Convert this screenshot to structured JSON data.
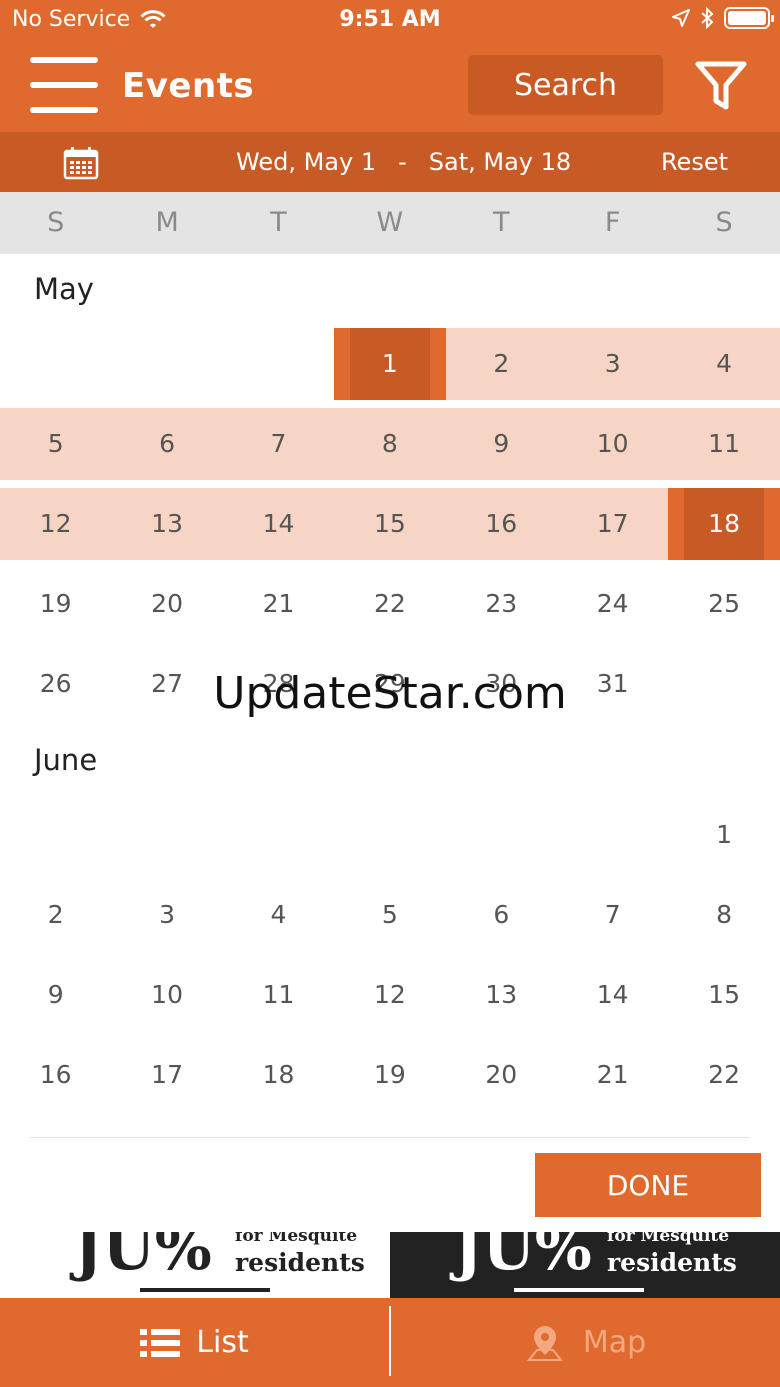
{
  "status": {
    "carrier": "No Service",
    "time": "9:51 AM"
  },
  "header": {
    "title": "Events",
    "search_label": "Search"
  },
  "date_bar": {
    "start": "Wed, May 1",
    "separator": "-",
    "end": "Sat, May 18",
    "reset_label": "Reset"
  },
  "weekdays": [
    "S",
    "M",
    "T",
    "W",
    "T",
    "F",
    "S"
  ],
  "months": [
    {
      "name": "May",
      "weeks": [
        [
          "",
          "",
          "",
          "1",
          "2",
          "3",
          "4"
        ],
        [
          "5",
          "6",
          "7",
          "8",
          "9",
          "10",
          "11"
        ],
        [
          "12",
          "13",
          "14",
          "15",
          "16",
          "17",
          "18"
        ],
        [
          "19",
          "20",
          "21",
          "22",
          "23",
          "24",
          "25"
        ],
        [
          "26",
          "27",
          "28",
          "29",
          "30",
          "31",
          ""
        ]
      ]
    },
    {
      "name": "June",
      "weeks": [
        [
          "",
          "",
          "",
          "",
          "",
          "",
          "1"
        ],
        [
          "2",
          "3",
          "4",
          "5",
          "6",
          "7",
          "8"
        ],
        [
          "9",
          "10",
          "11",
          "12",
          "13",
          "14",
          "15"
        ],
        [
          "16",
          "17",
          "18",
          "19",
          "20",
          "21",
          "22"
        ]
      ]
    }
  ],
  "selection": {
    "start_day": "1",
    "end_day": "18",
    "month": "May"
  },
  "watermark": "UpdateStar.com",
  "done_label": "DONE",
  "ad": {
    "big": "JU%",
    "line1": "for Mesquite",
    "line2": "residents"
  },
  "tabs": {
    "list_label": "List",
    "map_label": "Map"
  },
  "colors": {
    "primary": "#e06a2e",
    "dark": "#c85a25",
    "highlight": "#f7d5c5"
  }
}
